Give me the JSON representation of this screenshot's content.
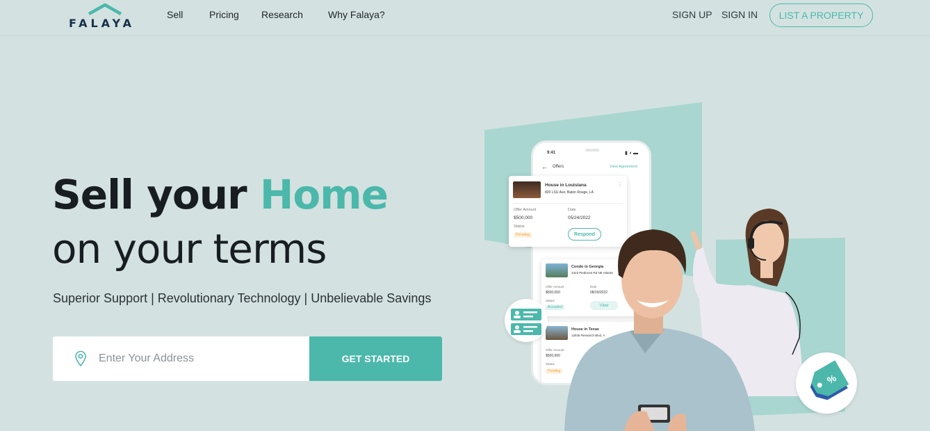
{
  "brand": {
    "name": "FALAYA",
    "accent": "#4bb8ab",
    "navy": "#17304a"
  },
  "nav": {
    "links": [
      "Sell",
      "Pricing",
      "Research",
      "Why Falaya?"
    ],
    "sign_up": "SIGN UP",
    "sign_in": "SIGN IN",
    "list_property": "LIST A PROPERTY"
  },
  "hero": {
    "title_part1": "Sell your ",
    "title_accent": "Home",
    "title_line2": "on your terms",
    "subtitle": "Superior Support | Revolutionary Technology | Unbelievable Savings",
    "search_placeholder": "Enter Your Address",
    "cta": "GET STARTED",
    "location_icon": "location-pin-icon"
  },
  "phone": {
    "time": "9:41",
    "screen_title": "Offers",
    "view_agreement": "View Agreement",
    "offers": [
      {
        "title": "House in Louisiana",
        "address": "820 LSU Ave, Baton Rouge, LA",
        "offer_label": "Offer Amount",
        "offer": "$500,000",
        "date_label": "Date",
        "date": "05/24/2022",
        "status_label": "Status",
        "status": "Pending",
        "action": "Respond"
      },
      {
        "title": "Condo in Georgia",
        "address": "3423 Piedmont Rd NE Atlanta",
        "offer_label": "Offer Amount",
        "offer": "$500,000",
        "date_label": "Date",
        "date": "08/20/2022",
        "status_label": "Status",
        "status": "Accepted",
        "action": "View"
      },
      {
        "title": "House in Texas",
        "address": "12845 Research Blvd, A",
        "offer_label": "Offer Amount",
        "offer": "$500,000",
        "status_label": "Status",
        "status": "Pending"
      }
    ]
  }
}
